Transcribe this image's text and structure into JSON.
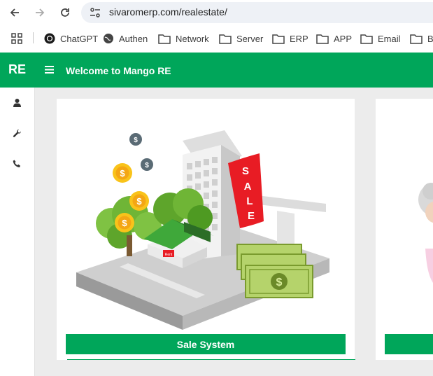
{
  "browser": {
    "url": "sivaromerp.com/realestate/",
    "bookmarks": [
      "ChatGPT",
      "Authen",
      "Network",
      "Server",
      "ERP",
      "APP",
      "Email",
      "Ba"
    ]
  },
  "appbar": {
    "brand": "RE",
    "title": "Welcome to Mango RE",
    "color": "#00a65a"
  },
  "sidebar": {
    "items": [
      {
        "icon": "user-icon"
      },
      {
        "icon": "wrench-icon"
      },
      {
        "icon": "phone-icon"
      }
    ]
  },
  "cards": [
    {
      "label": "Sale System",
      "sign_text": "SALE",
      "house_sign": "Rent"
    }
  ]
}
